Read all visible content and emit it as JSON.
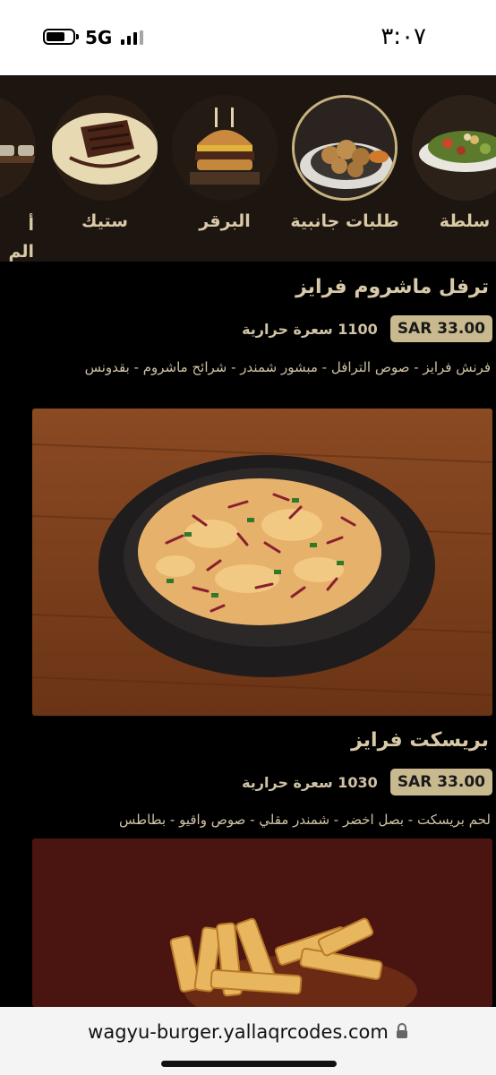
{
  "status_bar": {
    "network": "5G",
    "time": "٣:٠٧"
  },
  "categories": [
    {
      "label": "سلطة"
    },
    {
      "label": "طلبات جانبية",
      "active": true
    },
    {
      "label": "البرقر"
    },
    {
      "label": "ستيك"
    },
    {
      "label": "أ\nالم"
    }
  ],
  "items": [
    {
      "title": "ترفل ماشروم فرايز",
      "price": "SAR 33.00",
      "calories": "1100 سعرة حرارية",
      "description": "فرنش فرايز - صوص الترافل - مبشور شمندر - شرائح ماشروم - بقدونس"
    },
    {
      "title": "بريسكت فرايز",
      "price": "SAR 33.00",
      "calories": "1030 سعرة حرارية",
      "description": "لحم بريسكت - بصل اخضر - شمندر مقلي - صوص واقيو - بطاطس"
    }
  ],
  "url_bar": {
    "url": "wagyu-burger.yallaqrcodes.com"
  },
  "colors": {
    "accent": "#c8b98f",
    "text": "#d8c9a8",
    "background": "#000000"
  }
}
